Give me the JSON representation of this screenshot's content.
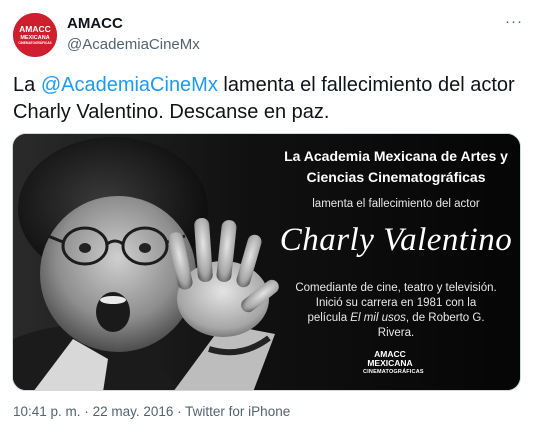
{
  "account": {
    "display_name": "AMACC",
    "handle": "@AcademiaCineMx",
    "avatar": {
      "line1": "AMACC",
      "line2": "MEXICANA",
      "line3": "CINEMATOGRÁFICAS"
    }
  },
  "tweet": {
    "text_before": "La ",
    "mention": "@AcademiaCineMx",
    "text_after": " lamenta el fallecimiento del actor Charly Valentino. Descanse en paz."
  },
  "card": {
    "heading_line1": "La Academia Mexicana de Artes y",
    "heading_line2": "Ciencias Cinematográficas",
    "subheading": "lamenta el fallecimiento del actor",
    "actor_name": "Charly Valentino",
    "bio_line1": "Comediante de cine, teatro y televisión.",
    "bio_line2": "Inició su carrera en 1981 con la",
    "bio_line3_before": "película ",
    "bio_line3_italic": "El mil usos",
    "bio_line3_after": ", de Roberto G.",
    "bio_line4": "Rivera.",
    "logo_line1": "AMACC",
    "logo_line2": "MEXICANA",
    "logo_line3": "CINEMATOGRÁFICAS"
  },
  "meta": {
    "time": "10:41 p. m.",
    "separator": "·",
    "date": "22 may. 2016",
    "source": "Twitter for iPhone"
  },
  "more_label": "···",
  "colors": {
    "link": "#1d9bf0",
    "muted": "#536471",
    "avatar_bg": "#cf1f2e"
  }
}
